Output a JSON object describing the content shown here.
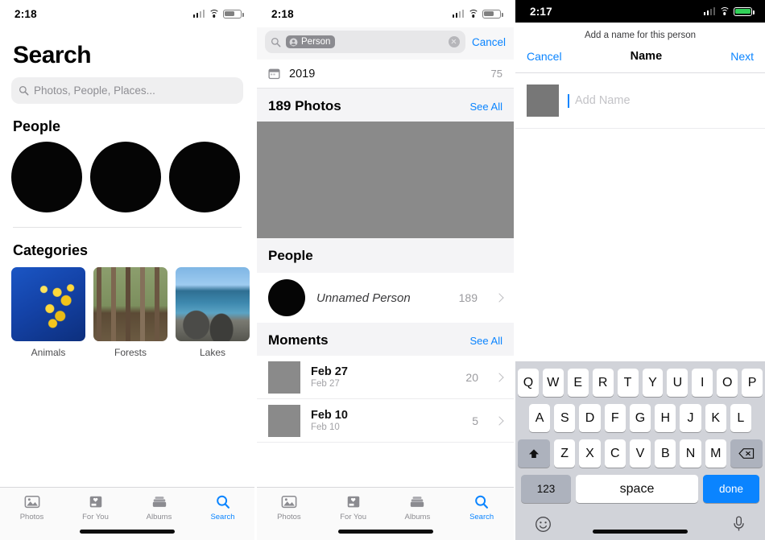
{
  "panel1": {
    "status": {
      "time": "2:18"
    },
    "title": "Search",
    "search_placeholder": "Photos, People, Places...",
    "people_heading": "People",
    "categories_heading": "Categories",
    "categories": [
      {
        "label": "Animals"
      },
      {
        "label": "Forests"
      },
      {
        "label": "Lakes"
      }
    ],
    "tabs": [
      {
        "label": "Photos",
        "icon": "photos-icon",
        "active": false
      },
      {
        "label": "For You",
        "icon": "for-you-icon",
        "active": false
      },
      {
        "label": "Albums",
        "icon": "albums-icon",
        "active": false
      },
      {
        "label": "Search",
        "icon": "search-icon",
        "active": true
      }
    ]
  },
  "panel2": {
    "status": {
      "time": "2:18"
    },
    "search_token": "Person",
    "cancel_label": "Cancel",
    "year_row": {
      "label": "2019",
      "count": "75"
    },
    "photos_section": {
      "title": "189 Photos",
      "see_all": "See All"
    },
    "people_section": {
      "title": "People",
      "person": {
        "name": "Unnamed Person",
        "count": "189"
      }
    },
    "moments_section": {
      "title": "Moments",
      "see_all": "See All",
      "items": [
        {
          "title": "Feb 27",
          "subtitle": "Feb 27",
          "count": "20"
        },
        {
          "title": "Feb 10",
          "subtitle": "Feb 10",
          "count": "5"
        }
      ]
    },
    "tabs": [
      {
        "label": "Photos",
        "active": false
      },
      {
        "label": "For You",
        "active": false
      },
      {
        "label": "Albums",
        "active": false
      },
      {
        "label": "Search",
        "active": true
      }
    ]
  },
  "panel3": {
    "status": {
      "time": "2:17"
    },
    "sheet_subtitle": "Add a name for this person",
    "cancel_label": "Cancel",
    "nav_title": "Name",
    "next_label": "Next",
    "name_placeholder": "Add Name",
    "keyboard": {
      "row1": [
        "Q",
        "W",
        "E",
        "R",
        "T",
        "Y",
        "U",
        "I",
        "O",
        "P"
      ],
      "row2": [
        "A",
        "S",
        "D",
        "F",
        "G",
        "H",
        "J",
        "K",
        "L"
      ],
      "row3": [
        "Z",
        "X",
        "C",
        "V",
        "B",
        "N",
        "M"
      ],
      "shift_icon": "shift-icon",
      "backspace_icon": "backspace-icon",
      "numbers_label": "123",
      "space_label": "space",
      "done_label": "done",
      "emoji_icon": "emoji-icon",
      "mic_icon": "microphone-icon"
    }
  },
  "colors": {
    "accent": "#0a84ff",
    "battery_green": "#31d158"
  }
}
